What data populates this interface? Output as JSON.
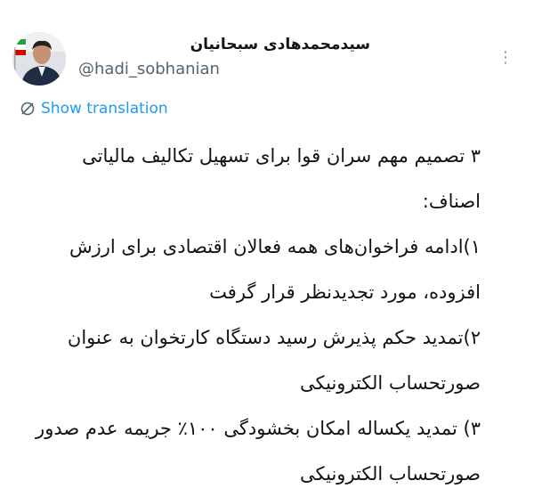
{
  "author": {
    "display_name": "سیدمحمدهادی سبحانیان",
    "handle": "@hadi_sobhanian",
    "avatar_icon": "profile-photo",
    "flag_colors": [
      "#239f40",
      "#ffffff",
      "#da0000"
    ]
  },
  "actions": {
    "more_icon": "more-vertical-icon",
    "more_glyph": "⋮",
    "translate_label": "Show translation",
    "translate_icon": "globe-slash-icon"
  },
  "tweet": {
    "lines": [
      "۳ تصمیم مهم سران قوا برای تسهیل تکالیف  مالیاتی",
      "اصناف:",
      "۱)ادامه فراخوان‌های همه فعالان اقتصادی برای ارزش",
      "افزوده، مورد تجدیدنظر قرار گرفت",
      "۲)تمدید حکم پذیرش رسید دستگاه کارتخوان به عنوان",
      "صورتحساب الکترونیکی",
      "۳) تمدید یکساله امکان بخشودگی ۱۰۰٪ جریمه عدم صدور",
      "صورتحساب الکترونیکی"
    ]
  },
  "colors": {
    "link": "#1d9bf0",
    "secondary_text": "#536471",
    "primary_text": "#0f1419"
  }
}
